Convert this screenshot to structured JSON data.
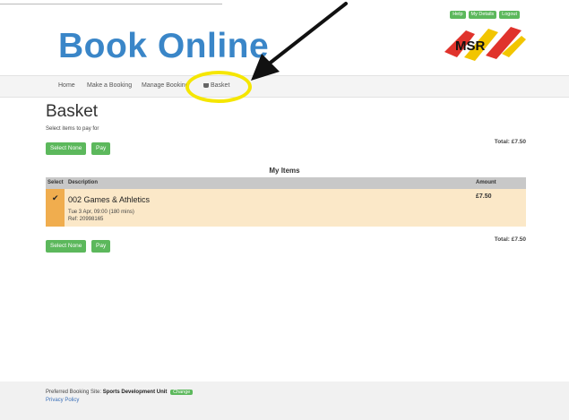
{
  "top_links": [
    "Help",
    "My Details",
    "Logout"
  ],
  "brand": "Book Online",
  "logo_text": "MSR",
  "nav": {
    "home": "Home",
    "make_booking": "Make a Booking",
    "manage_booking": "Manage Booking",
    "basket": "Basket"
  },
  "page": {
    "title": "Basket",
    "subtitle": "Select items to pay for",
    "select_none": "Select None",
    "pay": "Pay",
    "total": "Total: £7.50"
  },
  "items": {
    "heading": "My Items",
    "columns": [
      "Select",
      "Description",
      "Amount"
    ],
    "rows": [
      {
        "title": "002 Games & Athletics",
        "datetime": "Tue 3 Apr, 09:00 (180 mins)",
        "ref": "Ref: 20998165",
        "amount": "£7.50",
        "selected": true
      }
    ]
  },
  "footer": {
    "site_label": "Preferred Booking Site:",
    "site_name": "Sports Development Unit",
    "change": "Change",
    "privacy": "Privacy Policy"
  },
  "colors": {
    "brand": "#3a86c8",
    "button": "#5cb85c",
    "select_cell": "#f0ad4e",
    "row_bg": "#fbe8c8",
    "highlight": "#f5e600"
  },
  "icons": [
    "basket-icon",
    "checkmark-icon",
    "arrow-annotation"
  ]
}
